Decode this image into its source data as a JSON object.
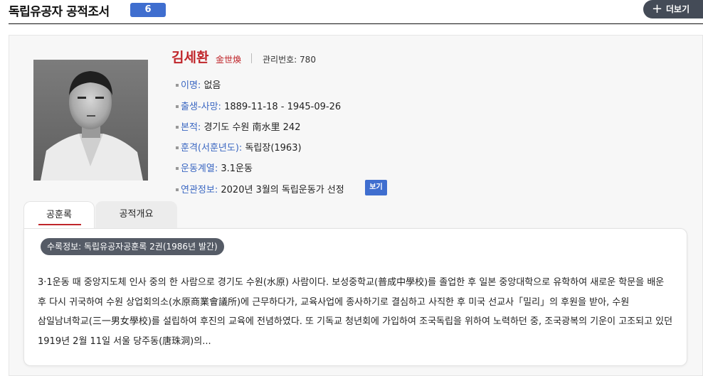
{
  "header": {
    "title": "독립유공자 공적조서",
    "count": "6",
    "more_label": "더보기"
  },
  "person": {
    "name": "김세환",
    "hanja": "金世煥",
    "management_label": "관리번호:",
    "management_no": "780",
    "fields": [
      {
        "label": "이명:",
        "value": "없음"
      },
      {
        "label": "출생-사망:",
        "value": "1889-11-18 - 1945-09-26"
      },
      {
        "label": "본적:",
        "value": "경기도 수원 南水里 242"
      },
      {
        "label": "훈격(서훈년도):",
        "value": "독립장(1963)"
      },
      {
        "label": "운동계열:",
        "value": "3.1운동"
      },
      {
        "label": "연관정보:",
        "value": "2020년 3월의 독립운동가 선정"
      }
    ],
    "view_button": "보기"
  },
  "tabs": [
    {
      "label": "공훈록",
      "active": true
    },
    {
      "label": "공적개요",
      "active": false
    }
  ],
  "record_source": "수록정보: 독립유공자공훈록 2권(1986년 발간)",
  "merit_text": "3·1운동 때 중앙지도체 인사 중의 한 사람으로 경기도 수원(水原) 사람이다. 보성중학교(普成中學校)를 졸업한 후 일본 중앙대학으로 유학하여 새로운 학문을 배운 후 다시 귀국하여 수원 상업회의소(水原商業會議所)에 근무하다가, 교육사업에 종사하기로 결심하고 사직한 후 미국 선교사「밀리」의 후원을 받아, 수원 삼일남녀학교(三一男女學校)를 설립하여 후진의 교육에 전념하였다. 또 기독교 청년회에 가입하여 조국독립을 위하여 노력하던 중, 조국광복의 기운이 고조되고 있던 1919년 2월 11일 서울 당주동(唐珠洞)의...",
  "colors": {
    "accent_blue": "#3f6ecf",
    "name_red": "#c0262b",
    "label_blue": "#3b67c2",
    "dark_button": "#444b57"
  },
  "icons": {
    "more": "plus-icon"
  }
}
